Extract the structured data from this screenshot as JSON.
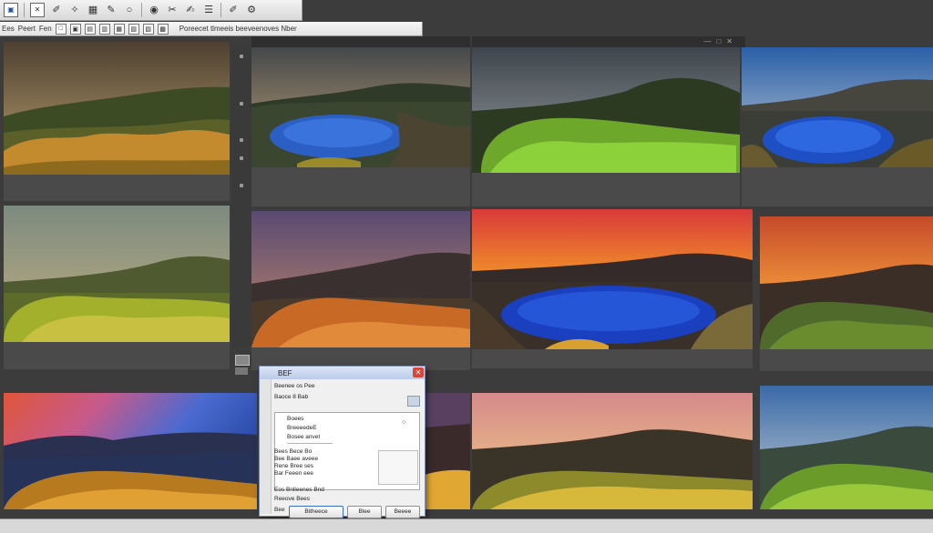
{
  "toolbar": {
    "icons": [
      "select-icon",
      "mark-icon",
      "crop-icon",
      "wand-icon",
      "frame-icon",
      "brush-icon",
      "circle-icon",
      "eyedropper-icon",
      "clone-icon",
      "edit-icon",
      "layers-icon",
      "dropper-icon",
      "gear-icon"
    ],
    "glyphs": [
      "▣",
      "✕",
      "✐",
      "✧",
      "▦",
      "✎",
      "○",
      "◉",
      "✂",
      "✍",
      "☰",
      "✐",
      "⚙"
    ]
  },
  "second_bar": {
    "label1": "Ees",
    "label2": "Peert",
    "label3": "Fen",
    "label4": "Poreecet tlmeeis beeveenoves Nber",
    "icons": [
      "□",
      "▣",
      "▤",
      "▥",
      "▦",
      "▧",
      "▨",
      "▩",
      "▪",
      "▫",
      "▬",
      "▭"
    ]
  },
  "panel_controls": [
    "—",
    "□",
    "✕"
  ],
  "dialog": {
    "title": "BEF",
    "close": "✕",
    "rows": [
      "Beenee os Pee",
      "Baoce 8 Bab",
      "Boees",
      "BreeeedeE",
      "Bosee anvet",
      "Bees Bece Bo",
      "Bee Baee aveee",
      "Rene Bree ses",
      "Bar Feeen eee",
      "Eos Bnlleenes Bnd",
      "Reeove Bees",
      "Bee"
    ],
    "buttons": [
      "Bitheece",
      "Blee",
      "Beeee"
    ]
  },
  "colors": {
    "window_bg": "#3c3c3c",
    "cell_bg": "#4a4a4a",
    "dialog_bg": "#f0f0f0",
    "dialog_title": "#b9cbe9",
    "close_button": "#d9473a"
  }
}
